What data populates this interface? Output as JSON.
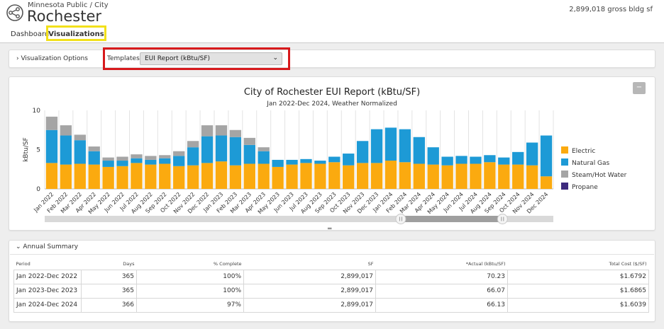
{
  "header": {
    "org_sub": "Minnesota Public / City",
    "org_name": "Rochester",
    "gross_sf": "2,899,018 gross bldg sf",
    "tabs": [
      "Dashboard",
      "Visualizations"
    ]
  },
  "options": {
    "toggle_label": "› Visualization Options",
    "templates_label": "Templates:",
    "templates_value": "EUI Report (kBtu/SF)",
    "expand_icon": "minus-icon"
  },
  "chart_data": {
    "type": "bar",
    "stacked": true,
    "title": "City of Rochester EUI Report (kBtu/SF)",
    "subtitle": "Jan 2022-Dec 2024, Weather Normalized",
    "ylabel": "kBtu/SF",
    "xlabel": "",
    "ylim": [
      0,
      10
    ],
    "yticks": [
      0,
      5,
      10
    ],
    "grid": false,
    "legend_position": "right",
    "categories": [
      "Jan 2022",
      "Feb 2022",
      "Mar 2022",
      "Apr 2022",
      "May 2022",
      "Jun 2022",
      "Jul 2022",
      "Aug 2022",
      "Sep 2022",
      "Oct 2022",
      "Nov 2022",
      "Dec 2022",
      "Jan 2023",
      "Feb 2023",
      "Mar 2023",
      "Apr 2023",
      "May 2023",
      "Jun 2023",
      "Jul 2023",
      "Aug 2023",
      "Sep 2023",
      "Oct 2023",
      "Nov 2023",
      "Dec 2023",
      "Jan 2024",
      "Feb 2024",
      "Mar 2024",
      "Apr 2024",
      "May 2024",
      "Jun 2024",
      "Jul 2024",
      "Aug 2024",
      "Sep 2024",
      "Oct 2024",
      "Nov 2024",
      "Dec 2024"
    ],
    "series": [
      {
        "name": "Electric",
        "color": "#fbaa0f",
        "values": [
          3.3,
          3.1,
          3.2,
          3.1,
          2.8,
          2.9,
          3.3,
          3.1,
          3.2,
          2.9,
          3.0,
          3.3,
          3.5,
          3.0,
          3.2,
          3.2,
          2.8,
          3.1,
          3.3,
          3.2,
          3.4,
          3.0,
          3.3,
          3.3,
          3.6,
          3.4,
          3.2,
          3.1,
          3.0,
          3.2,
          3.2,
          3.4,
          3.1,
          3.1,
          3.0,
          1.6
        ]
      },
      {
        "name": "Natural Gas",
        "color": "#1d9ad6",
        "values": [
          4.2,
          3.7,
          3.0,
          1.7,
          0.8,
          0.7,
          0.6,
          0.6,
          0.7,
          1.3,
          2.3,
          3.4,
          3.3,
          3.6,
          2.4,
          1.6,
          0.9,
          0.6,
          0.5,
          0.4,
          0.7,
          1.5,
          2.8,
          4.3,
          4.2,
          4.2,
          3.4,
          2.2,
          1.1,
          1.0,
          0.9,
          0.9,
          0.9,
          1.6,
          2.9,
          5.2
        ]
      },
      {
        "name": "Steam/Hot Water",
        "color": "#a5a5a5",
        "values": [
          1.7,
          1.3,
          0.7,
          0.6,
          0.4,
          0.5,
          0.5,
          0.5,
          0.4,
          0.6,
          0.8,
          1.4,
          1.3,
          0.9,
          0.9,
          0.5,
          0,
          0,
          0,
          0,
          0,
          0,
          0,
          0,
          0,
          0,
          0,
          0,
          0,
          0,
          0,
          0,
          0,
          0,
          0,
          0
        ]
      },
      {
        "name": "Propane",
        "color": "#3d2a7d",
        "values": [
          0,
          0,
          0,
          0,
          0,
          0,
          0,
          0,
          0,
          0,
          0,
          0,
          0,
          0,
          0,
          0,
          0,
          0,
          0,
          0,
          0,
          0,
          0,
          0,
          0,
          0,
          0,
          0,
          0,
          0,
          0,
          0,
          0,
          0,
          0,
          0
        ]
      }
    ],
    "range_selector": {
      "start_fraction": 0.7,
      "end_fraction": 0.9,
      "handle_icon": "pause-icon"
    }
  },
  "summary": {
    "title": "Annual Summary",
    "headers": [
      "Period",
      "Days",
      "% Complete",
      "SF",
      "*Actual (kBtu/SF)",
      "Total Cost ($/SF)"
    ],
    "rows": [
      [
        "Jan 2022-Dec 2022",
        "365",
        "100%",
        "2,899,017",
        "70.23",
        "$1.6792"
      ],
      [
        "Jan 2023-Dec 2023",
        "365",
        "100%",
        "2,899,017",
        "66.07",
        "$1.6865"
      ],
      [
        "Jan 2024-Dec 2024",
        "366",
        "97%",
        "2,899,017",
        "66.13",
        "$1.6039"
      ]
    ]
  }
}
